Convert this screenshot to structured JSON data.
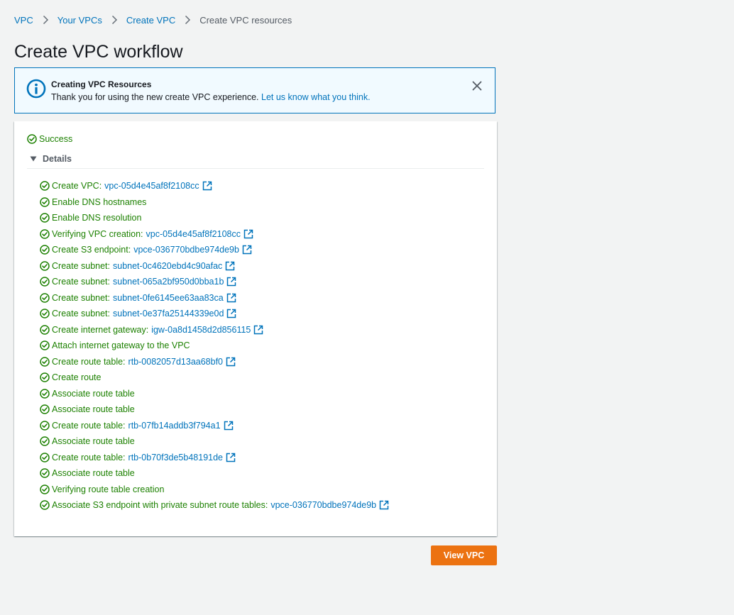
{
  "breadcrumb": {
    "items": [
      {
        "label": "VPC",
        "link": true
      },
      {
        "label": "Your VPCs",
        "link": true
      },
      {
        "label": "Create VPC",
        "link": true
      },
      {
        "label": "Create VPC resources",
        "link": false
      }
    ]
  },
  "page": {
    "title": "Create VPC workflow"
  },
  "flash": {
    "title": "Creating VPC Resources",
    "message": "Thank you for using the new create VPC experience. ",
    "link_text": "Let us know what you think.",
    "icon": "info-icon",
    "close_icon": "close-icon"
  },
  "result": {
    "status": "Success",
    "details_label": "Details",
    "steps": [
      {
        "label": "Create VPC:",
        "resource": "vpc-05d4e45af8f2108cc"
      },
      {
        "label": "Enable DNS hostnames",
        "resource": null
      },
      {
        "label": "Enable DNS resolution",
        "resource": null
      },
      {
        "label": "Verifying VPC creation:",
        "resource": "vpc-05d4e45af8f2108cc"
      },
      {
        "label": "Create S3 endpoint:",
        "resource": "vpce-036770bdbe974de9b"
      },
      {
        "label": "Create subnet:",
        "resource": "subnet-0c4620ebd4c90afac"
      },
      {
        "label": "Create subnet:",
        "resource": "subnet-065a2bf950d0bba1b"
      },
      {
        "label": "Create subnet:",
        "resource": "subnet-0fe6145ee63aa83ca"
      },
      {
        "label": "Create subnet:",
        "resource": "subnet-0e37fa25144339e0d"
      },
      {
        "label": "Create internet gateway:",
        "resource": "igw-0a8d1458d2d856115"
      },
      {
        "label": "Attach internet gateway to the VPC",
        "resource": null
      },
      {
        "label": "Create route table:",
        "resource": "rtb-0082057d13aa68bf0"
      },
      {
        "label": "Create route",
        "resource": null
      },
      {
        "label": "Associate route table",
        "resource": null
      },
      {
        "label": "Associate route table",
        "resource": null
      },
      {
        "label": "Create route table:",
        "resource": "rtb-07fb14addb3f794a1"
      },
      {
        "label": "Associate route table",
        "resource": null
      },
      {
        "label": "Create route table:",
        "resource": "rtb-0b70f3de5b48191de"
      },
      {
        "label": "Associate route table",
        "resource": null
      },
      {
        "label": "Verifying route table creation",
        "resource": null
      },
      {
        "label": "Associate S3 endpoint with private subnet route tables:",
        "resource": "vpce-036770bdbe974de9b"
      }
    ]
  },
  "actions": {
    "view_vpc_label": "View VPC"
  },
  "colors": {
    "link": "#0073bb",
    "success": "#1d8102",
    "primary_button": "#ec7211",
    "flash_background": "#f1faff",
    "page_background": "#f2f3f3"
  }
}
